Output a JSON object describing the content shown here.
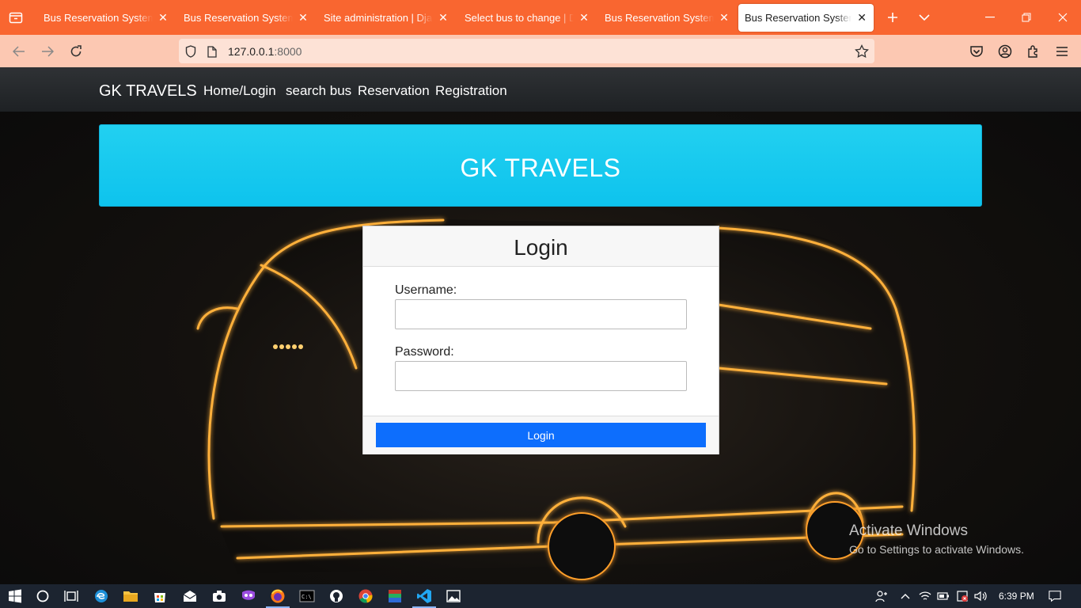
{
  "browser": {
    "tabs": [
      {
        "title": "Bus Reservation System in",
        "active": false
      },
      {
        "title": "Bus Reservation System in",
        "active": false
      },
      {
        "title": "Site administration | Djang",
        "active": false
      },
      {
        "title": "Select bus to change | Djar",
        "active": false
      },
      {
        "title": "Bus Reservation System in",
        "active": false
      },
      {
        "title": "Bus Reservation System in",
        "active": true
      }
    ],
    "url_host": "127.0.0.1",
    "url_port": ":8000"
  },
  "site": {
    "brand": "GK TRAVELS",
    "nav_links": [
      "Home/Login",
      "search bus",
      "Reservation",
      "Registration"
    ],
    "banner_title": "GK TRAVELS"
  },
  "login": {
    "title": "Login",
    "username_label": "Username:",
    "username_value": "",
    "password_label": "Password:",
    "password_value": "",
    "submit_label": "Login"
  },
  "watermark": {
    "title": "Activate Windows",
    "subtitle": "Go to Settings to activate Windows."
  },
  "taskbar": {
    "time": "6:39 PM"
  },
  "colors": {
    "tabstrip": "#f96630",
    "toolbar": "#fcc8b2",
    "banner": "#1ccbef",
    "button": "#0d6efd"
  }
}
